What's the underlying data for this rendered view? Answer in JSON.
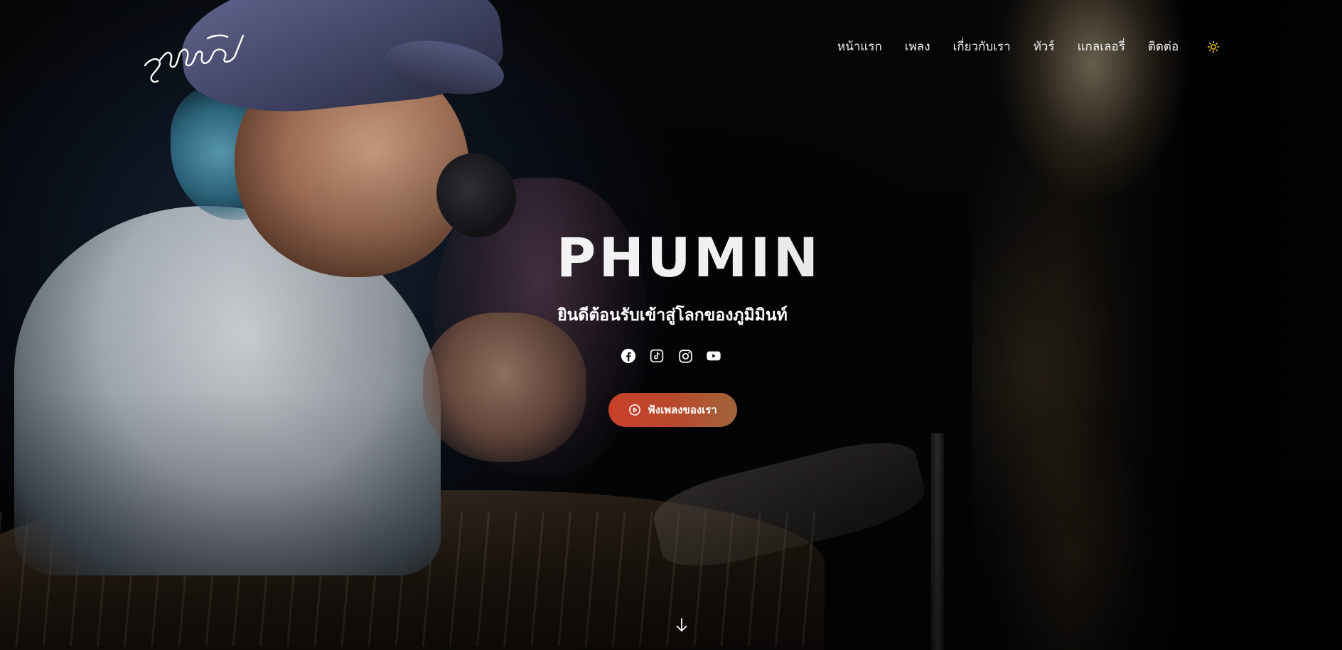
{
  "header": {
    "logo_text": "ภูมิมินท์",
    "nav": [
      {
        "label": "หน้าแรก"
      },
      {
        "label": "เพลง"
      },
      {
        "label": "เกี่ยวกับเรา"
      },
      {
        "label": "ทัวร์"
      },
      {
        "label": "แกลเลอรี่"
      },
      {
        "label": "ติดต่อ"
      }
    ],
    "theme_toggle_icon": "sun-icon"
  },
  "hero": {
    "title": "PHUMIN",
    "subtitle": "ยินดีต้อนรับเข้าสู่โลกของภูมิมินท์",
    "socials": [
      "facebook-icon",
      "tiktok-icon",
      "instagram-icon",
      "youtube-icon"
    ],
    "cta_label": "ฟังเพลงของเรา",
    "cta_icon": "play-circle-icon",
    "scroll_icon": "arrow-down-icon"
  },
  "colors": {
    "accent_start": "#c9402a",
    "accent_end": "#a0653a",
    "sun": "#f0c419",
    "text": "#ffffff"
  }
}
